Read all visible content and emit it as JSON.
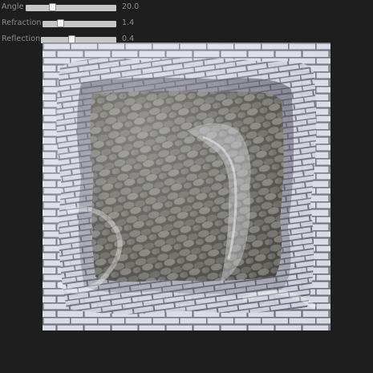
{
  "controls": [
    {
      "name": "angle",
      "label": "Angle",
      "value": "20.0",
      "fraction": 0.28
    },
    {
      "name": "refraction",
      "label": "Refraction",
      "value": "1.4",
      "fraction": 0.22
    },
    {
      "name": "reflection",
      "label": "Reflection",
      "value": "0.4",
      "fraction": 0.4
    }
  ],
  "scene": {
    "background_color": "#1e1e1e",
    "brick_color": "#d8dbe6",
    "mortar_color": "#6f7079",
    "stone_color": "#5e5d56"
  }
}
